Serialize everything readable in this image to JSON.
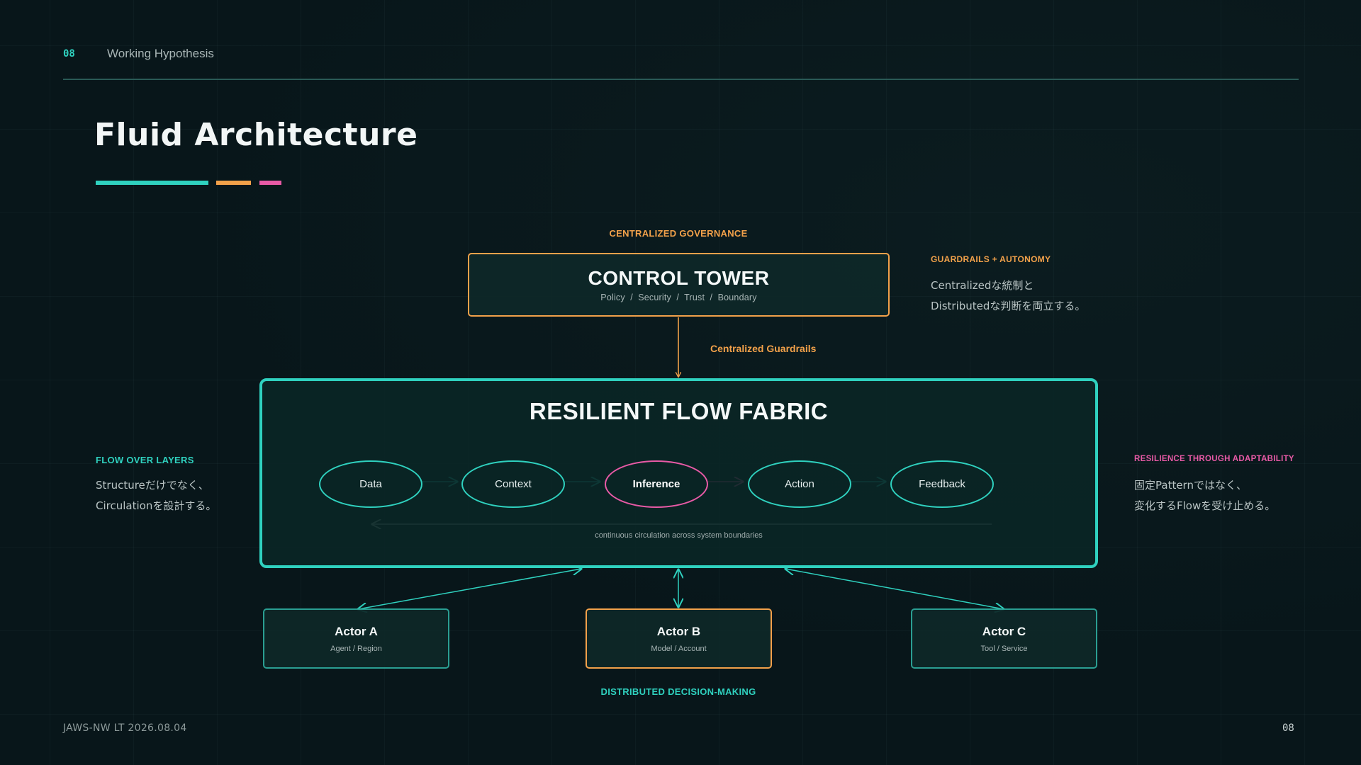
{
  "header": {
    "number": "08",
    "title": "Working Hypothesis"
  },
  "title": "Fluid Architecture",
  "colors": {
    "teal": "#2fd1bf",
    "orange": "#f2a14a",
    "pink": "#e85aa6",
    "background": "#08161a"
  },
  "top_label": "CENTRALIZED GOVERNANCE",
  "control_tower": {
    "title": "CONTROL TOWER",
    "items": [
      "Policy",
      "Security",
      "Trust",
      "Boundary"
    ],
    "separator": "/"
  },
  "guardrails_label": "Centralized Guardrails",
  "fabric": {
    "title": "RESILIENT FLOW FABRIC",
    "nodes": [
      "Data",
      "Context",
      "Inference",
      "Action",
      "Feedback"
    ],
    "highlighted_node": "Inference",
    "loop_caption": "continuous circulation across system boundaries"
  },
  "notes": {
    "right_top": {
      "heading": "GUARDRAILS + AUTONOMY",
      "line1": "Centralizedな統制と",
      "line2": "Distributedな判断を両立する。"
    },
    "left": {
      "heading": "FLOW OVER LAYERS",
      "line1": "Structureだけでなく、",
      "line2": "Circulationを設計する。"
    },
    "right": {
      "heading": "RESILIENCE THROUGH ADAPTABILITY",
      "line1": "固定Patternではなく、",
      "line2": "変化するFlowを受け止める。"
    }
  },
  "actors": [
    {
      "title": "Actor A",
      "subtitle": "Agent / Region"
    },
    {
      "title": "Actor B",
      "subtitle": "Model / Account"
    },
    {
      "title": "Actor C",
      "subtitle": "Tool / Service"
    }
  ],
  "bottom_label": "DISTRIBUTED DECISION-MAKING",
  "footer": {
    "left": "JAWS-NW LT 2026.08.04",
    "page": "08"
  }
}
